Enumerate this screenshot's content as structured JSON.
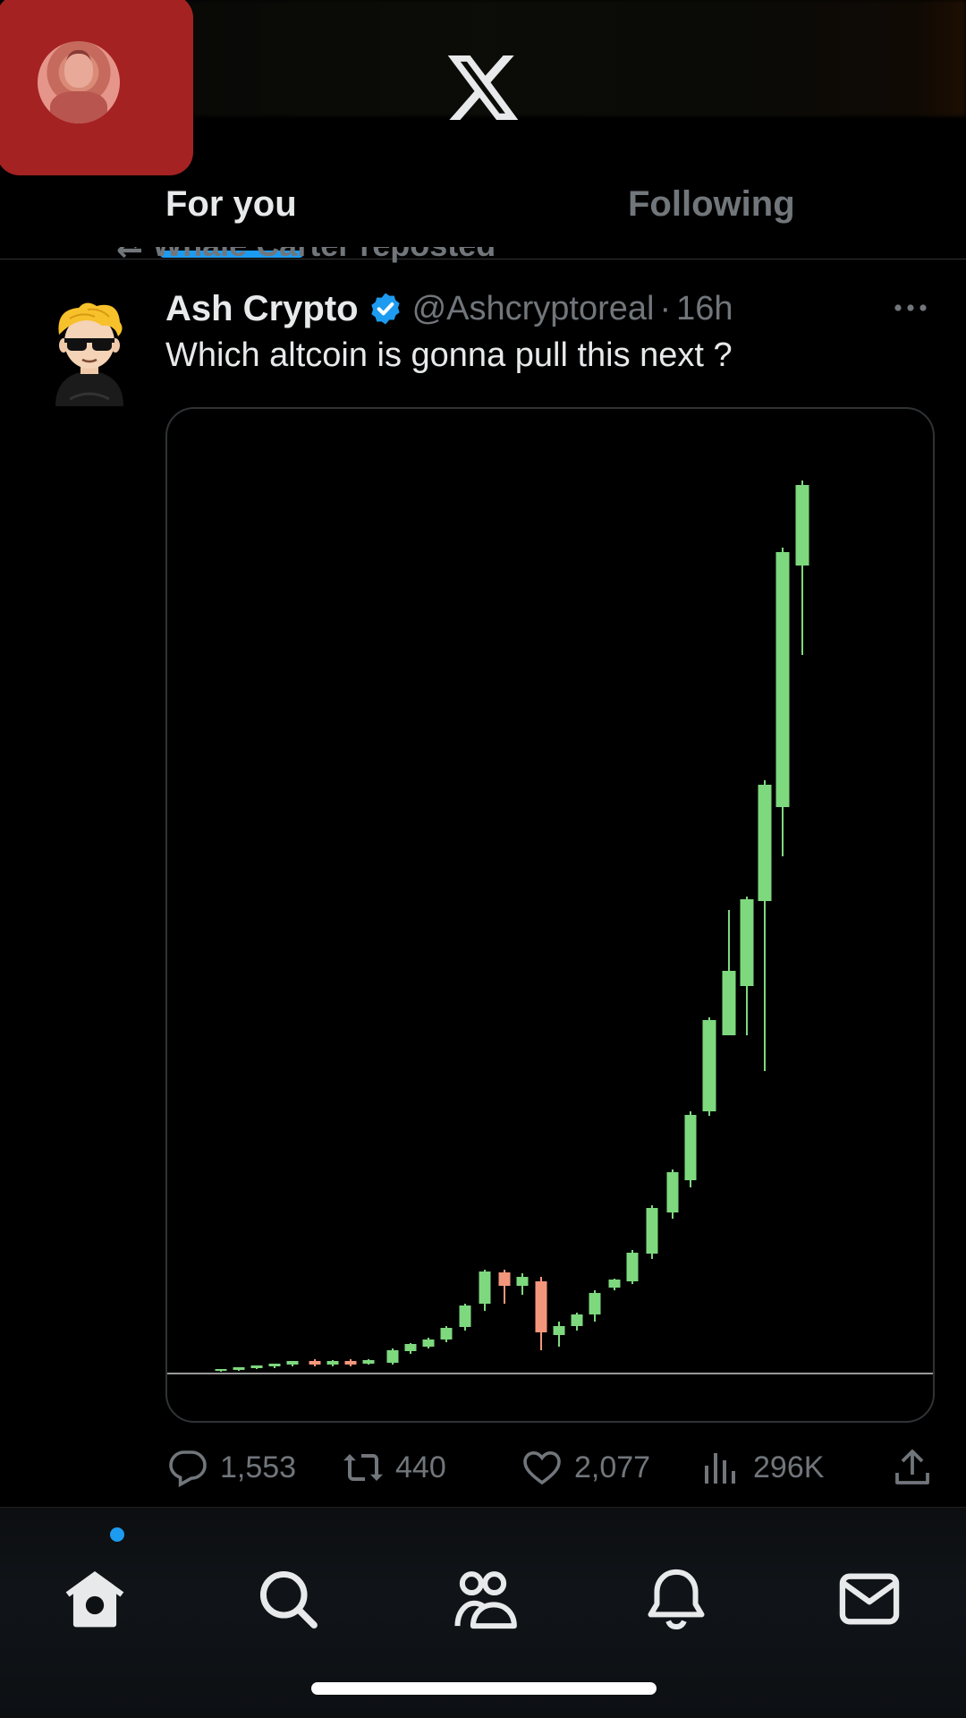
{
  "header": {
    "logo_icon": "x-logo-icon",
    "avatar_icon": "profile-avatar",
    "tabs": [
      {
        "label": "For you",
        "active": true
      },
      {
        "label": "Following",
        "active": false
      }
    ],
    "accent_color": "#1d9bf0"
  },
  "tweet": {
    "repost_text": "Whale Carter reposted",
    "author_name": "Ash Crypto",
    "verified": true,
    "handle": "@Ashcryptoreal",
    "separator": "·",
    "time": "16h",
    "text": "Which altcoin is gonna pull this next ?",
    "media": {
      "type": "candlestick-chart-image",
      "up_color": "#7ed87e",
      "down_color": "#f4967c"
    },
    "actions": {
      "replies": "1,553",
      "reposts": "440",
      "likes": "2,077",
      "views": "296K"
    }
  },
  "bottom_nav": {
    "items": [
      {
        "icon": "home-icon",
        "active": true,
        "has_dot": true
      },
      {
        "icon": "search-icon",
        "active": false
      },
      {
        "icon": "communities-icon",
        "active": false
      },
      {
        "icon": "notifications-icon",
        "active": false
      },
      {
        "icon": "messages-icon",
        "active": false
      }
    ]
  }
}
